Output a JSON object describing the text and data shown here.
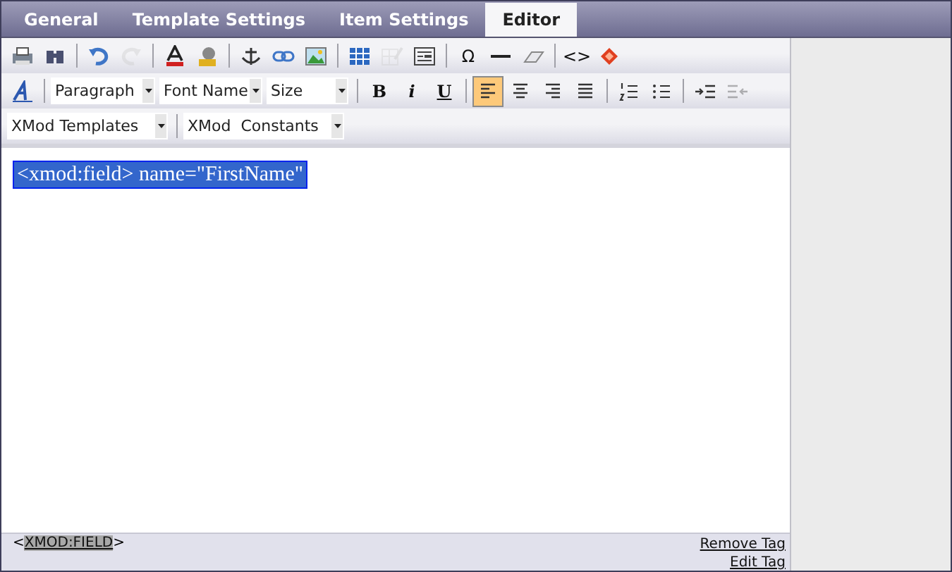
{
  "tabs": [
    {
      "label": "General",
      "selected": false
    },
    {
      "label": "Template Settings",
      "selected": false
    },
    {
      "label": "Item Settings",
      "selected": false
    },
    {
      "label": "Editor",
      "selected": true
    }
  ],
  "toolbar_row_1": [
    {
      "disabled": false
    },
    {
      "disabled": false
    },
    {
      "disabled": false
    },
    {
      "disabled": true
    },
    {
      "disabled": false
    },
    {
      "disabled": false
    },
    {
      "disabled": false
    },
    {
      "disabled": false
    },
    {
      "disabled": false
    },
    {
      "disabled": false
    },
    {
      "disabled": true
    },
    {
      "disabled": false
    },
    {
      "label": "Ω",
      "disabled": false
    },
    {
      "disabled": false
    },
    {
      "disabled": false
    },
    {
      "label": "<>",
      "disabled": false
    },
    {
      "disabled": false
    }
  ],
  "toolbar_row_2": {
    "dropdowns": [
      {
        "value": "Paragraph"
      },
      {
        "value": "Font Name"
      },
      {
        "value": "Size"
      }
    ],
    "format_buttons": [
      {
        "label": "B",
        "selected": false
      },
      {
        "label": "i",
        "selected": false
      },
      {
        "label": "U",
        "selected": false
      }
    ],
    "buttons": [
      {
        "selected": true,
        "disabled": false
      },
      {
        "selected": false,
        "disabled": false
      },
      {
        "selected": false,
        "disabled": false
      },
      {
        "selected": false,
        "disabled": false
      },
      {
        "selected": false,
        "disabled": false
      },
      {
        "selected": false,
        "disabled": false
      },
      {
        "selected": false,
        "disabled": false
      },
      {
        "selected": false,
        "disabled": true
      }
    ]
  },
  "toolbar_row_3": [
    {
      "value": "XMod Templates"
    },
    {
      "value": "XMod  Constants"
    }
  ],
  "content": {
    "text": "<xmod:field> name=\"FirstName\"",
    "selected": true
  },
  "status_bar": {
    "open": "<",
    "tag": "XMOD:FIELD",
    "close": ">",
    "links": [
      "Remove Tag",
      "Edit Tag"
    ]
  }
}
